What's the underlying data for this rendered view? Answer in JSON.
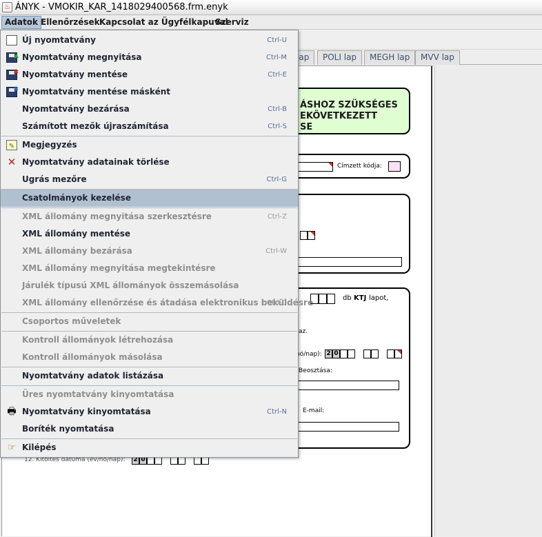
{
  "window": {
    "title": "ÁNYK - VMOKIR_KAR_1418029400568.frm.enyk"
  },
  "menubar": {
    "items": [
      "Adatok",
      "Ellenőrzések",
      "Kapcsolat az Ügyfélkapuval",
      "Szerviz"
    ]
  },
  "tabs": [
    "lap",
    "POLI lap",
    "MEGH lap",
    "MVV lap"
  ],
  "document": {
    "header_lines": [
      "ÁSHOZ SZÜKSÉGES",
      "EKÖVETKEZETT",
      "SE"
    ],
    "cimzett_label": "Címzett kódja:",
    "db_label": "db",
    "ktj_label": "KTJ",
    "lapot_label": "lapot,",
    "az_label": "az.",
    "datum_label": "hó/nap):",
    "datum_digits": [
      "2",
      "0"
    ],
    "beosztasa_label": "Beosztása:",
    "email_label": "E-mail:",
    "kitoltes_label": "12. Kitöltés dátuma (év/hó/nap):",
    "kitoltes_digits": [
      "2",
      "0"
    ]
  },
  "dropdown": {
    "items": [
      {
        "label": "Új nyomtatvány",
        "shortcut": "Ctrl-U",
        "icon": "new-document-icon"
      },
      {
        "label": "Nyomtatvány megnyitása",
        "shortcut": "Ctrl-M",
        "icon": "open-floppy-icon"
      },
      {
        "label": "Nyomtatvány mentése",
        "shortcut": "Ctrl-E",
        "icon": "save-floppy-icon"
      },
      {
        "label": "Nyomtatvány mentése másként",
        "shortcut": "",
        "icon": "save-as-floppy-icon"
      },
      {
        "label": "Nyomtatvány bezárása",
        "shortcut": "Ctrl-B",
        "icon": ""
      },
      {
        "label": "Számított mezők újraszámítása",
        "shortcut": "Ctrl-S",
        "icon": ""
      },
      {
        "label": "Megjegyzés",
        "shortcut": "",
        "icon": "note-icon"
      },
      {
        "label": "Nyomtatvány adatainak törlése",
        "shortcut": "",
        "icon": "delete-x-icon"
      },
      {
        "label": "Ugrás mezőre",
        "shortcut": "Ctrl-G",
        "icon": ""
      },
      {
        "label": "Csatolmányok kezelése",
        "shortcut": "",
        "icon": ""
      },
      {
        "label": "XML állomány megnyitása szerkesztésre",
        "shortcut": "Ctrl-Z",
        "icon": ""
      },
      {
        "label": "XML állomány mentése",
        "shortcut": "",
        "icon": ""
      },
      {
        "label": "XML állomány bezárása",
        "shortcut": "Ctrl-W",
        "icon": ""
      },
      {
        "label": "XML állomány megnyitása megtekintésre",
        "shortcut": "",
        "icon": ""
      },
      {
        "label": "Járulék típusú XML állományok összemásolása",
        "shortcut": "",
        "icon": ""
      },
      {
        "label": "XML állomány ellenőrzése és átadása elektronikus beküldésre",
        "shortcut": "Ctrl-D",
        "icon": ""
      },
      {
        "label": "Csoportos műveletek",
        "shortcut": "",
        "icon": ""
      },
      {
        "label": "Kontroll állományok létrehozása",
        "shortcut": "",
        "icon": ""
      },
      {
        "label": "Kontroll állományok másolása",
        "shortcut": "",
        "icon": ""
      },
      {
        "label": "Nyomtatvány adatok listázása",
        "shortcut": "",
        "icon": ""
      },
      {
        "label": "Üres nyomtatvány kinyomtatása",
        "shortcut": "",
        "icon": ""
      },
      {
        "label": "Nyomtatvány kinyomtatása",
        "shortcut": "Ctrl-N",
        "icon": "printer-icon"
      },
      {
        "label": "Boríték nyomtatása",
        "shortcut": "",
        "icon": ""
      },
      {
        "label": "Kilépés",
        "shortcut": "",
        "icon": "exit-hand-icon"
      }
    ]
  }
}
